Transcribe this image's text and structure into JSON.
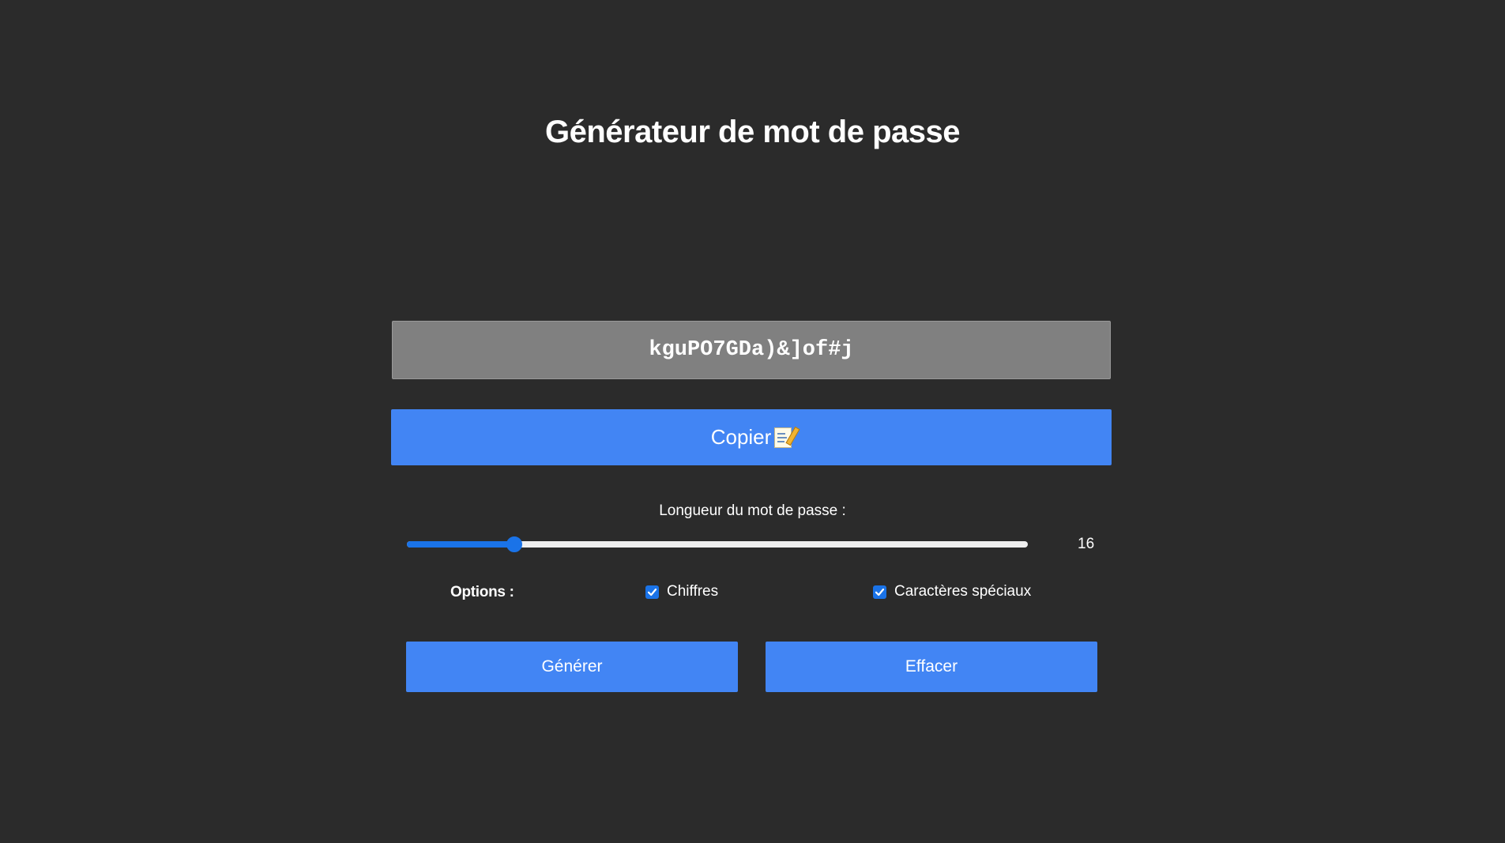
{
  "header": {
    "title": "Générateur de mot de passe"
  },
  "password": {
    "value": "kguPO7GDa)&]of#j"
  },
  "copy_button": {
    "label": "Copier",
    "icon": "memo-icon"
  },
  "length": {
    "label": "Longueur du mot de passe :",
    "value": "16",
    "min": 6,
    "max": 64
  },
  "options": {
    "label": "Options :",
    "items": [
      {
        "label": "Chiffres",
        "checked": true
      },
      {
        "label": "Caractères spéciaux",
        "checked": true
      }
    ]
  },
  "actions": {
    "generate_label": "Générer",
    "clear_label": "Effacer"
  },
  "colors": {
    "background": "#2b2b2b",
    "accent": "#4285f4",
    "slider": "#1a73e8",
    "output_background": "#808080"
  }
}
